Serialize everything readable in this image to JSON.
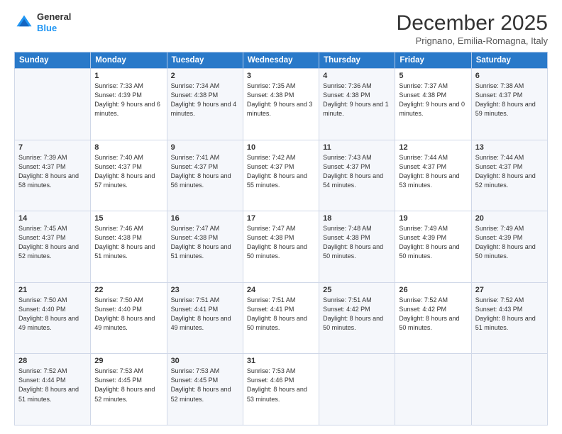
{
  "logo": {
    "general": "General",
    "blue": "Blue"
  },
  "header": {
    "month": "December 2025",
    "location": "Prignano, Emilia-Romagna, Italy"
  },
  "weekdays": [
    "Sunday",
    "Monday",
    "Tuesday",
    "Wednesday",
    "Thursday",
    "Friday",
    "Saturday"
  ],
  "weeks": [
    [
      {
        "day": "",
        "sunrise": "",
        "sunset": "",
        "daylight": ""
      },
      {
        "day": "1",
        "sunrise": "Sunrise: 7:33 AM",
        "sunset": "Sunset: 4:39 PM",
        "daylight": "Daylight: 9 hours and 6 minutes."
      },
      {
        "day": "2",
        "sunrise": "Sunrise: 7:34 AM",
        "sunset": "Sunset: 4:38 PM",
        "daylight": "Daylight: 9 hours and 4 minutes."
      },
      {
        "day": "3",
        "sunrise": "Sunrise: 7:35 AM",
        "sunset": "Sunset: 4:38 PM",
        "daylight": "Daylight: 9 hours and 3 minutes."
      },
      {
        "day": "4",
        "sunrise": "Sunrise: 7:36 AM",
        "sunset": "Sunset: 4:38 PM",
        "daylight": "Daylight: 9 hours and 1 minute."
      },
      {
        "day": "5",
        "sunrise": "Sunrise: 7:37 AM",
        "sunset": "Sunset: 4:38 PM",
        "daylight": "Daylight: 9 hours and 0 minutes."
      },
      {
        "day": "6",
        "sunrise": "Sunrise: 7:38 AM",
        "sunset": "Sunset: 4:37 PM",
        "daylight": "Daylight: 8 hours and 59 minutes."
      }
    ],
    [
      {
        "day": "7",
        "sunrise": "Sunrise: 7:39 AM",
        "sunset": "Sunset: 4:37 PM",
        "daylight": "Daylight: 8 hours and 58 minutes."
      },
      {
        "day": "8",
        "sunrise": "Sunrise: 7:40 AM",
        "sunset": "Sunset: 4:37 PM",
        "daylight": "Daylight: 8 hours and 57 minutes."
      },
      {
        "day": "9",
        "sunrise": "Sunrise: 7:41 AM",
        "sunset": "Sunset: 4:37 PM",
        "daylight": "Daylight: 8 hours and 56 minutes."
      },
      {
        "day": "10",
        "sunrise": "Sunrise: 7:42 AM",
        "sunset": "Sunset: 4:37 PM",
        "daylight": "Daylight: 8 hours and 55 minutes."
      },
      {
        "day": "11",
        "sunrise": "Sunrise: 7:43 AM",
        "sunset": "Sunset: 4:37 PM",
        "daylight": "Daylight: 8 hours and 54 minutes."
      },
      {
        "day": "12",
        "sunrise": "Sunrise: 7:44 AM",
        "sunset": "Sunset: 4:37 PM",
        "daylight": "Daylight: 8 hours and 53 minutes."
      },
      {
        "day": "13",
        "sunrise": "Sunrise: 7:44 AM",
        "sunset": "Sunset: 4:37 PM",
        "daylight": "Daylight: 8 hours and 52 minutes."
      }
    ],
    [
      {
        "day": "14",
        "sunrise": "Sunrise: 7:45 AM",
        "sunset": "Sunset: 4:37 PM",
        "daylight": "Daylight: 8 hours and 52 minutes."
      },
      {
        "day": "15",
        "sunrise": "Sunrise: 7:46 AM",
        "sunset": "Sunset: 4:38 PM",
        "daylight": "Daylight: 8 hours and 51 minutes."
      },
      {
        "day": "16",
        "sunrise": "Sunrise: 7:47 AM",
        "sunset": "Sunset: 4:38 PM",
        "daylight": "Daylight: 8 hours and 51 minutes."
      },
      {
        "day": "17",
        "sunrise": "Sunrise: 7:47 AM",
        "sunset": "Sunset: 4:38 PM",
        "daylight": "Daylight: 8 hours and 50 minutes."
      },
      {
        "day": "18",
        "sunrise": "Sunrise: 7:48 AM",
        "sunset": "Sunset: 4:38 PM",
        "daylight": "Daylight: 8 hours and 50 minutes."
      },
      {
        "day": "19",
        "sunrise": "Sunrise: 7:49 AM",
        "sunset": "Sunset: 4:39 PM",
        "daylight": "Daylight: 8 hours and 50 minutes."
      },
      {
        "day": "20",
        "sunrise": "Sunrise: 7:49 AM",
        "sunset": "Sunset: 4:39 PM",
        "daylight": "Daylight: 8 hours and 50 minutes."
      }
    ],
    [
      {
        "day": "21",
        "sunrise": "Sunrise: 7:50 AM",
        "sunset": "Sunset: 4:40 PM",
        "daylight": "Daylight: 8 hours and 49 minutes."
      },
      {
        "day": "22",
        "sunrise": "Sunrise: 7:50 AM",
        "sunset": "Sunset: 4:40 PM",
        "daylight": "Daylight: 8 hours and 49 minutes."
      },
      {
        "day": "23",
        "sunrise": "Sunrise: 7:51 AM",
        "sunset": "Sunset: 4:41 PM",
        "daylight": "Daylight: 8 hours and 49 minutes."
      },
      {
        "day": "24",
        "sunrise": "Sunrise: 7:51 AM",
        "sunset": "Sunset: 4:41 PM",
        "daylight": "Daylight: 8 hours and 50 minutes."
      },
      {
        "day": "25",
        "sunrise": "Sunrise: 7:51 AM",
        "sunset": "Sunset: 4:42 PM",
        "daylight": "Daylight: 8 hours and 50 minutes."
      },
      {
        "day": "26",
        "sunrise": "Sunrise: 7:52 AM",
        "sunset": "Sunset: 4:42 PM",
        "daylight": "Daylight: 8 hours and 50 minutes."
      },
      {
        "day": "27",
        "sunrise": "Sunrise: 7:52 AM",
        "sunset": "Sunset: 4:43 PM",
        "daylight": "Daylight: 8 hours and 51 minutes."
      }
    ],
    [
      {
        "day": "28",
        "sunrise": "Sunrise: 7:52 AM",
        "sunset": "Sunset: 4:44 PM",
        "daylight": "Daylight: 8 hours and 51 minutes."
      },
      {
        "day": "29",
        "sunrise": "Sunrise: 7:53 AM",
        "sunset": "Sunset: 4:45 PM",
        "daylight": "Daylight: 8 hours and 52 minutes."
      },
      {
        "day": "30",
        "sunrise": "Sunrise: 7:53 AM",
        "sunset": "Sunset: 4:45 PM",
        "daylight": "Daylight: 8 hours and 52 minutes."
      },
      {
        "day": "31",
        "sunrise": "Sunrise: 7:53 AM",
        "sunset": "Sunset: 4:46 PM",
        "daylight": "Daylight: 8 hours and 53 minutes."
      },
      {
        "day": "",
        "sunrise": "",
        "sunset": "",
        "daylight": ""
      },
      {
        "day": "",
        "sunrise": "",
        "sunset": "",
        "daylight": ""
      },
      {
        "day": "",
        "sunrise": "",
        "sunset": "",
        "daylight": ""
      }
    ]
  ]
}
